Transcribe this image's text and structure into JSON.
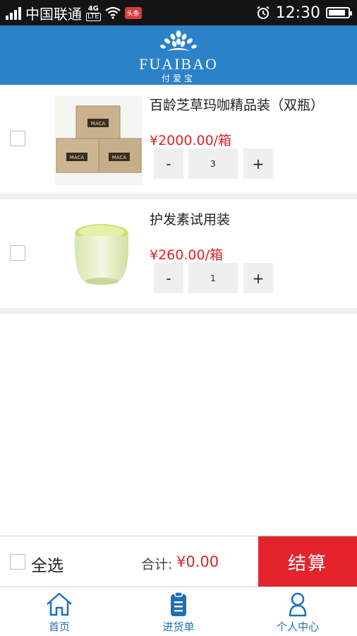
{
  "status_bar": {
    "carrier": "中国联通",
    "network": "4G",
    "network_sub": "LTE",
    "notification_badge": "头条",
    "time": "12:30",
    "battery_level": 0.9
  },
  "header": {
    "brand": "FUAIBAO",
    "brand_sub": "付爱宝",
    "brand_color": "#2b82c9"
  },
  "cart": {
    "items": [
      {
        "name": "百龄芝草玛咖精品装（双瓶）",
        "price": "¥2000.00/箱",
        "quantity": "3",
        "minus_label": "-",
        "plus_label": "+",
        "image_icon": "maca-boxes-image"
      },
      {
        "name": "护发素试用装",
        "price": "¥260.00/箱",
        "quantity": "1",
        "minus_label": "-",
        "plus_label": "+",
        "image_icon": "cream-jar-image"
      }
    ]
  },
  "checkout": {
    "select_all_label": "全选",
    "total_label": "合计:",
    "total_value": "¥0.00",
    "checkout_label": "结算",
    "accent_color": "#e4232a"
  },
  "tabbar": {
    "tabs": [
      {
        "label": "首页",
        "icon": "home-icon"
      },
      {
        "label": "进货单",
        "icon": "clipboard-icon"
      },
      {
        "label": "个人中心",
        "icon": "person-icon"
      }
    ],
    "active_color": "#1f6fb8"
  }
}
